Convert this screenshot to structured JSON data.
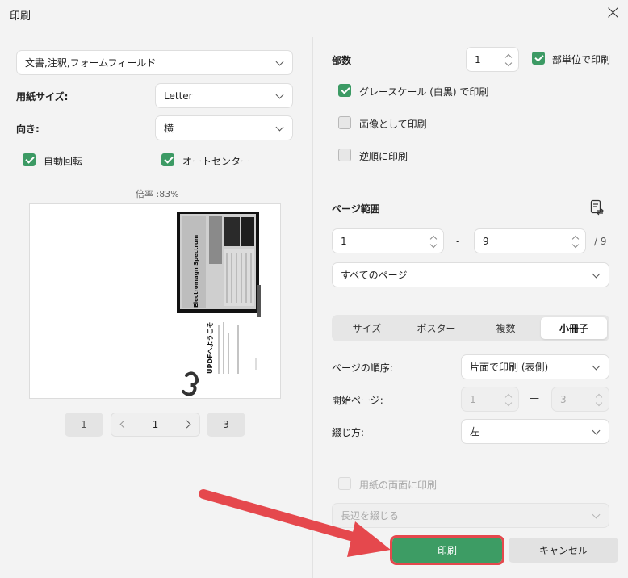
{
  "window": {
    "title": "印刷",
    "close_icon": "close-icon"
  },
  "left": {
    "content_select": "文書,注釈,フォームフィールド",
    "paper_size_label": "用紙サイズ:",
    "paper_size_value": "Letter",
    "orientation_label": "向き:",
    "orientation_value": "横",
    "auto_rotate": {
      "label": "自動回転",
      "checked": true
    },
    "auto_center": {
      "label": "オートセンター",
      "checked": true
    },
    "zoom_label": "倍率 :83%",
    "pager": {
      "first": "1",
      "current": "1",
      "last": "3"
    },
    "preview_texts": {
      "spectrum_title": "Electromagn Spectrum",
      "welcome": "UPDFへようこそ"
    }
  },
  "right": {
    "copies_label": "部数",
    "copies_value": "1",
    "collate": {
      "label": "部単位で印刷",
      "checked": true
    },
    "grayscale": {
      "label": "グレースケール (白黒) で印刷",
      "checked": true
    },
    "as_image": {
      "label": "画像として印刷",
      "checked": false
    },
    "reverse": {
      "label": "逆順に印刷",
      "checked": false
    },
    "page_range_label": "ページ範囲",
    "range_from": "1",
    "range_dash": "-",
    "range_to": "9",
    "range_total": "/ 9",
    "range_select": "すべてのページ",
    "tabs": [
      "サイズ",
      "ポスター",
      "複数",
      "小冊子"
    ],
    "active_tab": "小冊子",
    "page_order_label": "ページの順序:",
    "page_order_value": "片面で印刷 (表側)",
    "start_page_label": "開始ページ:",
    "start_from": "1",
    "start_dash": "—",
    "start_to": "3",
    "binding_label": "綴じ方:",
    "binding_value": "左",
    "duplex": {
      "label": "用紙の両面に印刷",
      "checked": false
    },
    "edge_select": "長辺を綴じる"
  },
  "buttons": {
    "print": "印刷",
    "cancel": "キャンセル"
  },
  "colors": {
    "accent": "#3d9c64",
    "highlight_outline": "#e5484d",
    "arrow": "#e5484d"
  }
}
